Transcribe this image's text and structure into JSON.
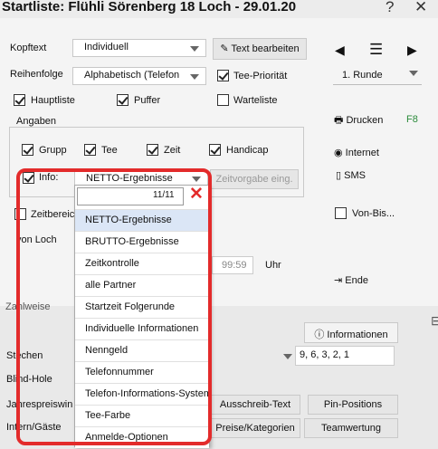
{
  "window": {
    "title": "Startliste: Flühli Sörenberg 18 Loch - 29.01.20",
    "help": "?",
    "close": "✕"
  },
  "form": {
    "kopftext_label": "Kopftext",
    "kopftext_value": "Individuell",
    "text_edit_button": "Text bearbeiten",
    "reihenfolge_label": "Reihenfolge",
    "reihenfolge_value": "Alphabetisch (Telefon",
    "tee_prioritaet": "Tee-Priorität",
    "hauptliste": "Hauptliste",
    "puffer": "Puffer",
    "warteliste": "Warteliste",
    "angaben_legend": "Angaben",
    "grupp": "Grupp",
    "tee": "Tee",
    "zeit": "Zeit",
    "handicap": "Handicap",
    "info_label": "Info:",
    "info_value": "NETTO-Ergebnisse",
    "zeitvorgabe": "Zeitvorgabe eing.",
    "zeitbereich": "Zeitbereich",
    "von_loch": "von Loch",
    "time_value": "99:59",
    "uhr": "Uhr",
    "informationen": "Informationen",
    "stechen": "Stechen",
    "stechen_value": "9, 6, 3, 2, 1",
    "blind_hole": "Blind-Hole",
    "jahrespreiswin": "Jahrespreiswin",
    "intern_gaeste": "Intern/Gäste",
    "zahlweise": "Zahlweise",
    "ausschreib_text": "Ausschreib-Text",
    "pin_positions": "Pin-Positions",
    "preise_kategorien": "Preise/Kategorien",
    "teamwertung": "Teamwertung"
  },
  "side": {
    "runde_value": "1. Runde",
    "drucken": "Drucken",
    "drucken_key": "F8",
    "internet": "Internet",
    "sms": "SMS",
    "von_bis": "Von-Bis...",
    "ende": "Ende"
  },
  "dropdown": {
    "filter": "",
    "count": "11/11",
    "items": [
      "NETTO-Ergebnisse",
      "BRUTTO-Ergebnisse",
      "Zeitkontrolle",
      "alle Partner",
      "Startzeit Folgerunde",
      "Individuelle Informationen",
      "Nenngeld",
      "Telefonnummer",
      "Telefon-Informations-System",
      "Tee-Farbe",
      "Anmelde-Optionen"
    ]
  },
  "colors": {
    "highlight": "#e32b2b",
    "selected": "#dbe6f6"
  }
}
